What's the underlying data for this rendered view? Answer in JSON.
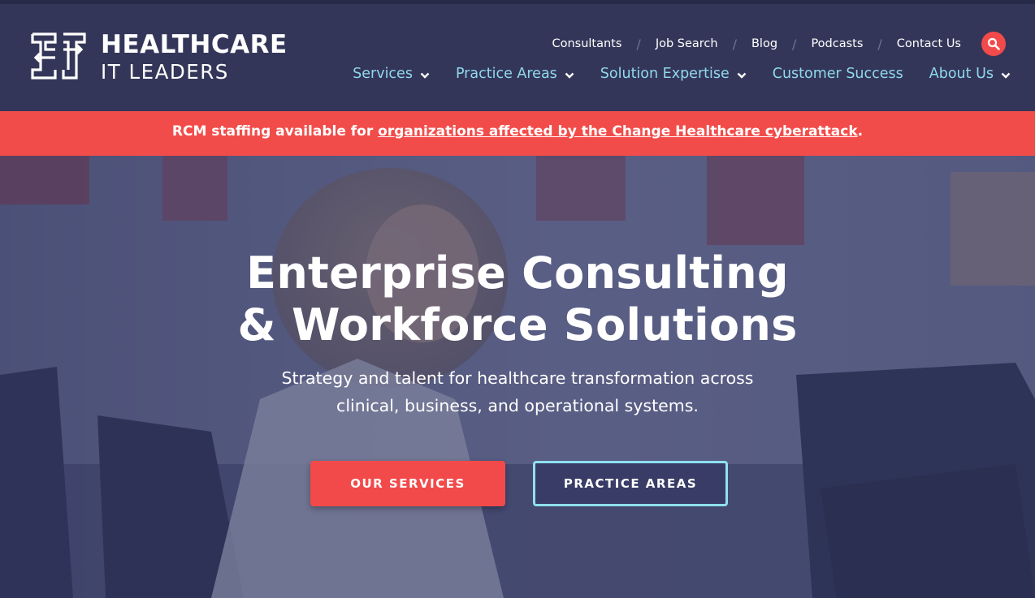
{
  "brand": {
    "name_line1": "HEALTHCARE",
    "name_line2": "IT LEADERS"
  },
  "utility_nav": [
    {
      "label": "Consultants"
    },
    {
      "label": "Job Search"
    },
    {
      "label": "Blog"
    },
    {
      "label": "Podcasts"
    },
    {
      "label": "Contact Us"
    }
  ],
  "main_nav": [
    {
      "label": "Services",
      "has_dropdown": true
    },
    {
      "label": "Practice Areas",
      "has_dropdown": true
    },
    {
      "label": "Solution Expertise",
      "has_dropdown": true
    },
    {
      "label": "Customer Success",
      "has_dropdown": false
    },
    {
      "label": "About Us",
      "has_dropdown": true
    }
  ],
  "alert": {
    "prefix": "RCM staffing available for ",
    "link_text": "organizations affected by the Change Healthcare cyberattack",
    "suffix": "."
  },
  "hero": {
    "title_line1": "Enterprise Consulting",
    "title_line2": "& Workforce Solutions",
    "subtitle_line1": "Strategy and talent for healthcare transformation across",
    "subtitle_line2": "clinical, business, and operational systems.",
    "primary_button": "OUR SERVICES",
    "secondary_button": "PRACTICE AREAS"
  },
  "icons": {
    "search": "search-icon",
    "chevron": "chevron-down-icon",
    "logo": "logo-mark-icon"
  },
  "colors": {
    "header_bg": "#343659",
    "nav_link": "#8fd9ec",
    "accent_red": "#f24a4a",
    "alert_bg": "#f24c4a",
    "secondary_border": "#8fe0ef"
  }
}
